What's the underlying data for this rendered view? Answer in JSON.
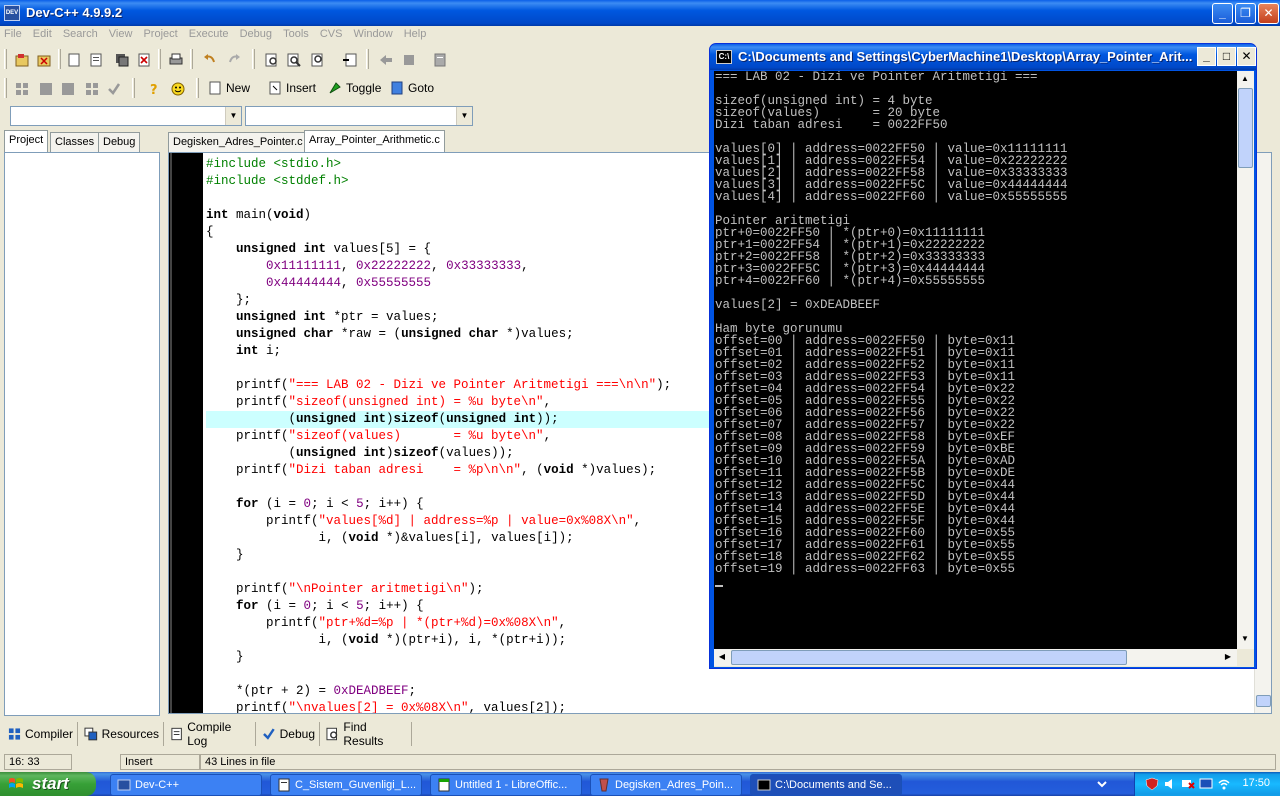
{
  "window": {
    "title": "Dev-C++ 4.9.9.2",
    "app_icon_text": "DEV"
  },
  "menu": [
    "File",
    "Edit",
    "Search",
    "View",
    "Project",
    "Execute",
    "Debug",
    "Tools",
    "CVS",
    "Window",
    "Help"
  ],
  "toolbar2": {
    "new_label": "New",
    "insert_label": "Insert",
    "toggle_label": "Toggle",
    "goto_label": "Goto"
  },
  "left_tabs": [
    "Project",
    "Classes",
    "Debug"
  ],
  "file_tabs": [
    "Degisken_Adres_Pointer.c",
    "Array_Pointer_Arithmetic.c"
  ],
  "code_lines": [
    [
      {
        "t": "#include <stdio.h>",
        "c": "pp"
      }
    ],
    [
      {
        "t": "#include <stddef.h>",
        "c": "pp"
      }
    ],
    [],
    [
      {
        "t": "int",
        "c": "kw"
      },
      {
        "t": " main("
      },
      {
        "t": "void",
        "c": "kw"
      },
      {
        "t": ")"
      }
    ],
    [
      {
        "t": "{"
      }
    ],
    [
      {
        "t": "    "
      },
      {
        "t": "unsigned int",
        "c": "kw"
      },
      {
        "t": " values[5] = {"
      }
    ],
    [
      {
        "t": "        "
      },
      {
        "t": "0x11111111",
        "c": "num"
      },
      {
        "t": ", "
      },
      {
        "t": "0x22222222",
        "c": "num"
      },
      {
        "t": ", "
      },
      {
        "t": "0x33333333",
        "c": "num"
      },
      {
        "t": ","
      }
    ],
    [
      {
        "t": "        "
      },
      {
        "t": "0x44444444",
        "c": "num"
      },
      {
        "t": ", "
      },
      {
        "t": "0x55555555",
        "c": "num"
      }
    ],
    [
      {
        "t": "    };"
      }
    ],
    [
      {
        "t": "    "
      },
      {
        "t": "unsigned int",
        "c": "kw"
      },
      {
        "t": " *ptr = values;"
      }
    ],
    [
      {
        "t": "    "
      },
      {
        "t": "unsigned char",
        "c": "kw"
      },
      {
        "t": " *raw = ("
      },
      {
        "t": "unsigned char",
        "c": "kw"
      },
      {
        "t": " *)values;"
      }
    ],
    [
      {
        "t": "    "
      },
      {
        "t": "int",
        "c": "kw"
      },
      {
        "t": " i;"
      }
    ],
    [],
    [
      {
        "t": "    printf("
      },
      {
        "t": "\"=== LAB 02 - Dizi ve Pointer Aritmetigi ===\\n\\n\"",
        "c": "str"
      },
      {
        "t": ");"
      }
    ],
    [
      {
        "t": "    printf("
      },
      {
        "t": "\"sizeof(unsigned int) = %u byte\\n\"",
        "c": "str"
      },
      {
        "t": ","
      }
    ],
    [
      {
        "t": "           ("
      },
      {
        "t": "unsigned int",
        "c": "kw"
      },
      {
        "t": ")"
      },
      {
        "t": "sizeof",
        "c": "kw"
      },
      {
        "t": "("
      },
      {
        "t": "unsigned int",
        "c": "kw"
      },
      {
        "t": "));"
      }
    ],
    [
      {
        "t": "    printf("
      },
      {
        "t": "\"sizeof(values)       = %u byte\\n\"",
        "c": "str"
      },
      {
        "t": ","
      }
    ],
    [
      {
        "t": "           ("
      },
      {
        "t": "unsigned int",
        "c": "kw"
      },
      {
        "t": ")"
      },
      {
        "t": "sizeof",
        "c": "kw"
      },
      {
        "t": "(values));"
      }
    ],
    [
      {
        "t": "    printf("
      },
      {
        "t": "\"Dizi taban adresi    = %p\\n\\n\"",
        "c": "str"
      },
      {
        "t": ", ("
      },
      {
        "t": "void",
        "c": "kw"
      },
      {
        "t": " *)values);"
      }
    ],
    [],
    [
      {
        "t": "    "
      },
      {
        "t": "for",
        "c": "kw"
      },
      {
        "t": " (i = "
      },
      {
        "t": "0",
        "c": "num"
      },
      {
        "t": "; i < "
      },
      {
        "t": "5",
        "c": "num"
      },
      {
        "t": "; i++) {"
      }
    ],
    [
      {
        "t": "        printf("
      },
      {
        "t": "\"values[%d] | address=%p | value=0x%08X\\n\"",
        "c": "str"
      },
      {
        "t": ","
      }
    ],
    [
      {
        "t": "               i, ("
      },
      {
        "t": "void",
        "c": "kw"
      },
      {
        "t": " *)&values[i], values[i]);"
      }
    ],
    [
      {
        "t": "    }"
      }
    ],
    [],
    [
      {
        "t": "    printf("
      },
      {
        "t": "\"\\nPointer aritmetigi\\n\"",
        "c": "str"
      },
      {
        "t": ");"
      }
    ],
    [
      {
        "t": "    "
      },
      {
        "t": "for",
        "c": "kw"
      },
      {
        "t": " (i = "
      },
      {
        "t": "0",
        "c": "num"
      },
      {
        "t": "; i < "
      },
      {
        "t": "5",
        "c": "num"
      },
      {
        "t": "; i++) {"
      }
    ],
    [
      {
        "t": "        printf("
      },
      {
        "t": "\"ptr+%d=%p | *(ptr+%d)=0x%08X\\n\"",
        "c": "str"
      },
      {
        "t": ","
      }
    ],
    [
      {
        "t": "               i, ("
      },
      {
        "t": "void",
        "c": "kw"
      },
      {
        "t": " *)(ptr+i), i, *(ptr+i));"
      }
    ],
    [
      {
        "t": "    }"
      }
    ],
    [],
    [
      {
        "t": "    *(ptr + 2) = "
      },
      {
        "t": "0xDEADBEEF",
        "c": "num"
      },
      {
        "t": ";"
      }
    ],
    [
      {
        "t": "    printf("
      },
      {
        "t": "\"\\nvalues[2] = 0x%08X\\n\"",
        "c": "str"
      },
      {
        "t": ", values[2]);"
      }
    ]
  ],
  "highlighted_line": 15,
  "bottom_tabs": [
    "Compiler",
    "Resources",
    "Compile Log",
    "Debug",
    "Find Results"
  ],
  "status": {
    "position": "16: 33",
    "mode": "Insert",
    "lines": "43 Lines in file"
  },
  "console": {
    "title": "C:\\Documents and Settings\\CyberMachine1\\Desktop\\Array_Pointer_Arit...",
    "icon_text": "C:\\",
    "lines": [
      "=== LAB 02 - Dizi ve Pointer Aritmetigi ===",
      "",
      "sizeof(unsigned int) = 4 byte",
      "sizeof(values)       = 20 byte",
      "Dizi taban adresi    = 0022FF50",
      "",
      "values[0] | address=0022FF50 | value=0x11111111",
      "values[1] | address=0022FF54 | value=0x22222222",
      "values[2] | address=0022FF58 | value=0x33333333",
      "values[3] | address=0022FF5C | value=0x44444444",
      "values[4] | address=0022FF60 | value=0x55555555",
      "",
      "Pointer aritmetigi",
      "ptr+0=0022FF50 | *(ptr+0)=0x11111111",
      "ptr+1=0022FF54 | *(ptr+1)=0x22222222",
      "ptr+2=0022FF58 | *(ptr+2)=0x33333333",
      "ptr+3=0022FF5C | *(ptr+3)=0x44444444",
      "ptr+4=0022FF60 | *(ptr+4)=0x55555555",
      "",
      "values[2] = 0xDEADBEEF",
      "",
      "Ham byte gorunumu",
      "offset=00 | address=0022FF50 | byte=0x11",
      "offset=01 | address=0022FF51 | byte=0x11",
      "offset=02 | address=0022FF52 | byte=0x11",
      "offset=03 | address=0022FF53 | byte=0x11",
      "offset=04 | address=0022FF54 | byte=0x22",
      "offset=05 | address=0022FF55 | byte=0x22",
      "offset=06 | address=0022FF56 | byte=0x22",
      "offset=07 | address=0022FF57 | byte=0x22",
      "offset=08 | address=0022FF58 | byte=0xEF",
      "offset=09 | address=0022FF59 | byte=0xBE",
      "offset=10 | address=0022FF5A | byte=0xAD",
      "offset=11 | address=0022FF5B | byte=0xDE",
      "offset=12 | address=0022FF5C | byte=0x44",
      "offset=13 | address=0022FF5D | byte=0x44",
      "offset=14 | address=0022FF5E | byte=0x44",
      "offset=15 | address=0022FF5F | byte=0x44",
      "offset=16 | address=0022FF60 | byte=0x55",
      "offset=17 | address=0022FF61 | byte=0x55",
      "offset=18 | address=0022FF62 | byte=0x55",
      "offset=19 | address=0022FF63 | byte=0x55"
    ]
  },
  "taskbar": {
    "start_label": "start",
    "tasks": [
      "Dev-C++",
      "C_Sistem_Guvenligi_L...",
      "Untitled 1 - LibreOffic...",
      "Degisken_Adres_Poin...",
      "C:\\Documents and Se..."
    ],
    "clock": "17:50"
  },
  "colors": {
    "xp_blue": "#0054e3",
    "highlight": "#ccffff",
    "string": "#ff0000",
    "number": "#800080",
    "preprocessor": "#008000"
  }
}
